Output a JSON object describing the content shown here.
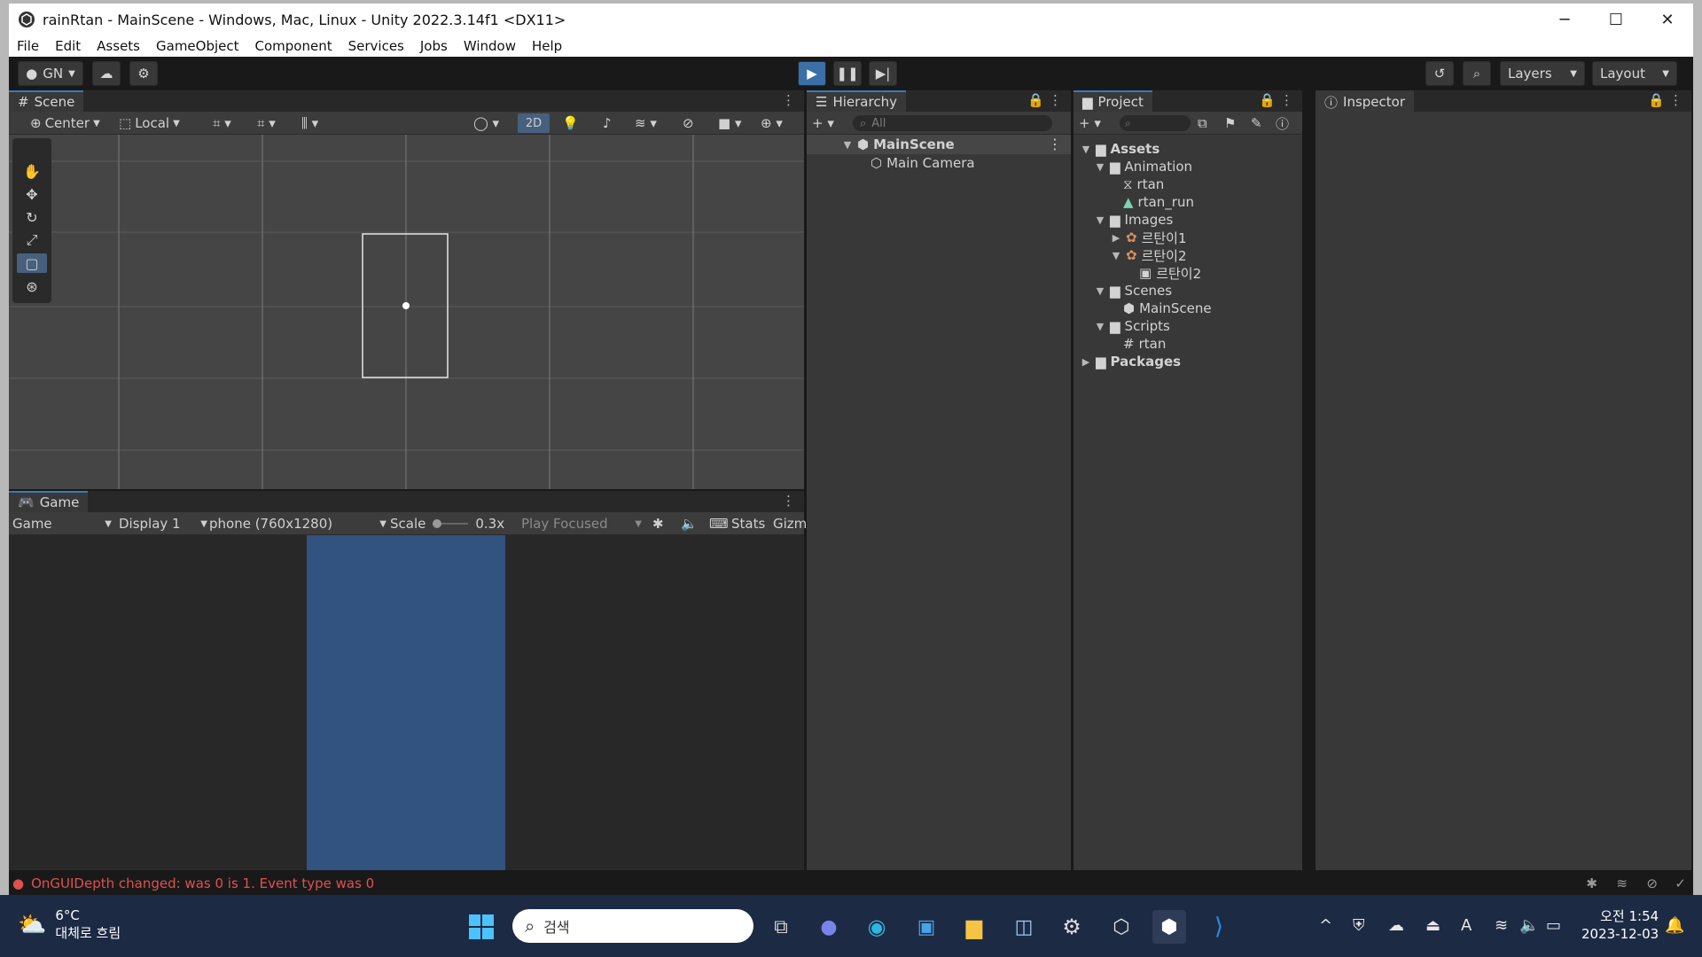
{
  "window": {
    "title": "rainRtan - MainScene - Windows, Mac, Linux - Unity 2022.3.14f1 <DX11>",
    "controls": [
      "─",
      "☐",
      "✕"
    ]
  },
  "menu": [
    "File",
    "Edit",
    "Assets",
    "GameObject",
    "Component",
    "Services",
    "Jobs",
    "Window",
    "Help"
  ],
  "toolbar": {
    "account": "GN",
    "layers": "Layers",
    "layout": "Layout"
  },
  "scene": {
    "tab": "Scene",
    "pivot": "Center",
    "space": "Local",
    "mode_2d": "2D"
  },
  "game": {
    "tab": "Game",
    "view": "Game",
    "display": "Display 1",
    "resolution": "phone (760x1280)",
    "scale_label": "Scale",
    "scale_value": "0.3x",
    "play_focused": "Play Focused",
    "stats": "Stats",
    "gizmos": "Gizm",
    "camera_color": "#325280"
  },
  "hierarchy": {
    "tab": "Hierarchy",
    "search_placeholder": "All",
    "scene_name": "MainScene",
    "object": "Main Camera"
  },
  "project": {
    "tab": "Project",
    "tree": {
      "assets": "Assets",
      "animation": "Animation",
      "anim_rtan": "rtan",
      "anim_rtan_run": "rtan_run",
      "images": "Images",
      "img1": "르탄이1",
      "img2": "르탄이2",
      "img2_child": "르탄이2",
      "scenes": "Scenes",
      "scene_main": "MainScene",
      "scripts": "Scripts",
      "script_rtan": "rtan",
      "packages": "Packages"
    }
  },
  "inspector": {
    "tab": "Inspector"
  },
  "status": {
    "message": "OnGUIDepth changed: was 0 is 1. Event type was 0",
    "color": "#e05050"
  },
  "taskbar": {
    "weather_temp": "6°C",
    "weather_desc": "대체로 흐림",
    "search_placeholder": "검색",
    "time": "오전 1:54",
    "date": "2023-12-03"
  }
}
